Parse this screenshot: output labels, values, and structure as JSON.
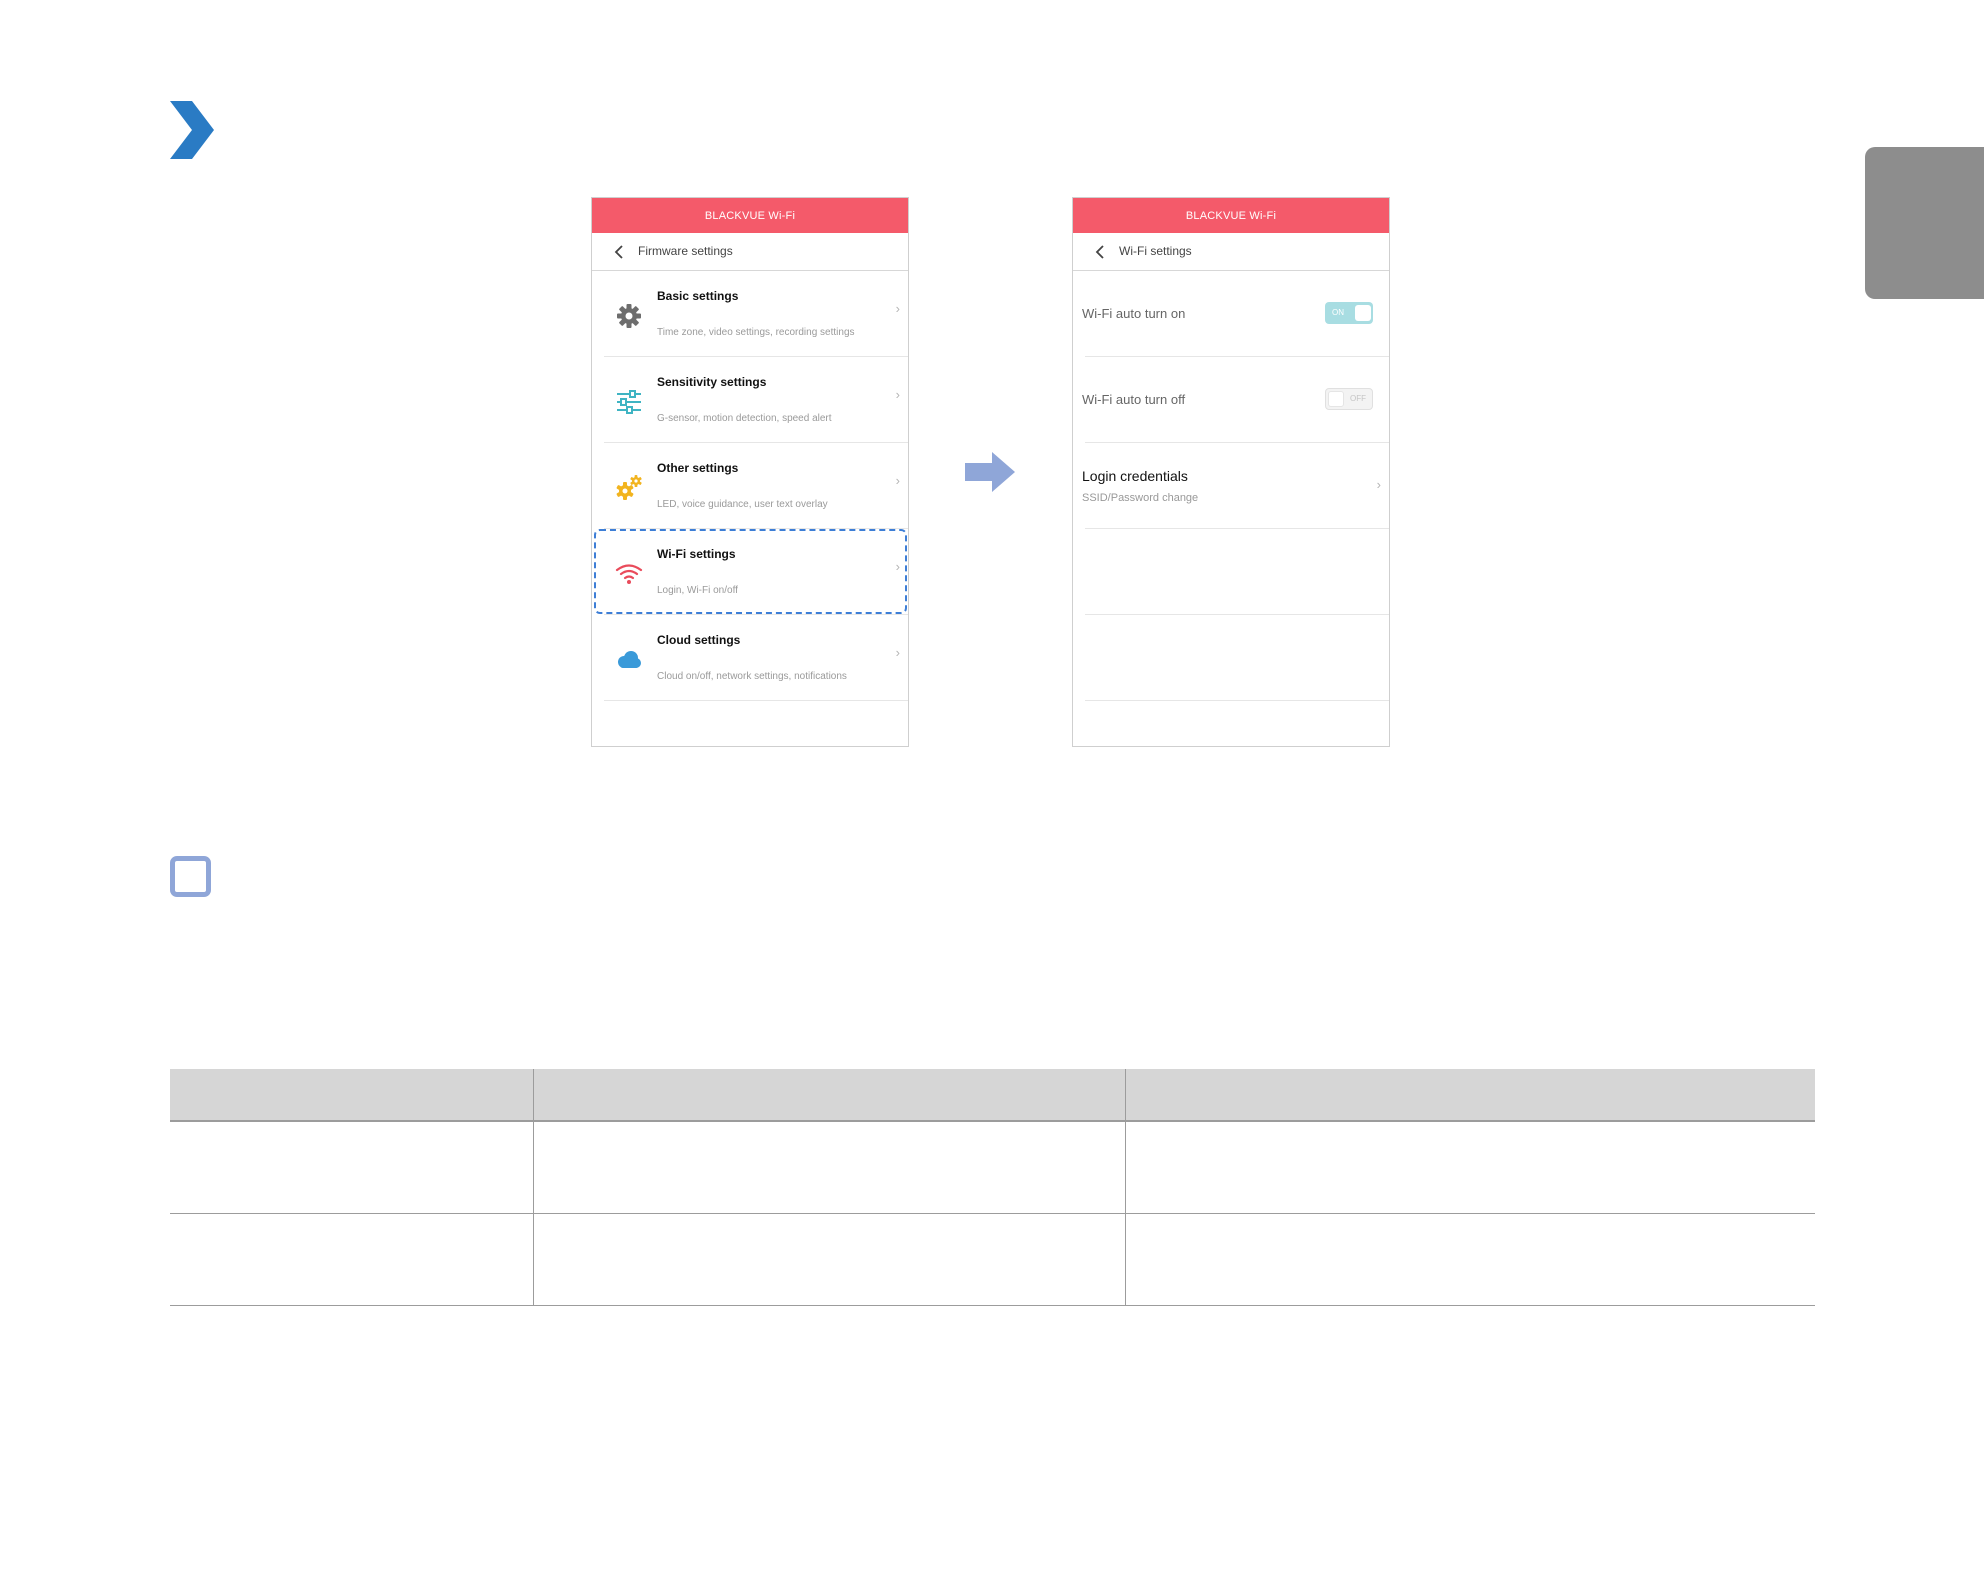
{
  "left_screen": {
    "app_title": "BLACKVUE Wi-Fi",
    "nav_title": "Firmware settings",
    "items": [
      {
        "title": "Basic settings",
        "subtitle": "Time zone, video settings, recording settings",
        "icon": "gear-icon"
      },
      {
        "title": "Sensitivity settings",
        "subtitle": "G-sensor, motion detection, speed alert",
        "icon": "sliders-icon"
      },
      {
        "title": "Other settings",
        "subtitle": "LED, voice guidance, user text overlay",
        "icon": "gears-icon"
      },
      {
        "title": "Wi-Fi settings",
        "subtitle": "Login, Wi-Fi on/off",
        "icon": "wifi-icon"
      },
      {
        "title": "Cloud settings",
        "subtitle": "Cloud on/off, network settings, notifications",
        "icon": "cloud-icon"
      }
    ],
    "highlighted_item": "Wi-Fi settings"
  },
  "right_screen": {
    "app_title": "BLACKVUE Wi-Fi",
    "nav_title": "Wi-Fi settings",
    "auto_on": {
      "label": "Wi-Fi auto turn on",
      "state": "ON"
    },
    "auto_off": {
      "label": "Wi-Fi auto turn off",
      "state": "OFF"
    },
    "login": {
      "title": "Login credentials",
      "subtitle": "SSID/Password change"
    }
  },
  "colors": {
    "header": "#f45a6a",
    "accent_blue": "#2a7bc4",
    "flow_arrow": "#8fa6d8",
    "highlight": "#3d7ed6",
    "toggle_on": "#a8dde2"
  },
  "icons": {
    "section_marker": "chevron-right-icon",
    "note_marker": "note-square-icon",
    "flow": "arrow-right-icon",
    "back": "chevron-left-icon"
  }
}
